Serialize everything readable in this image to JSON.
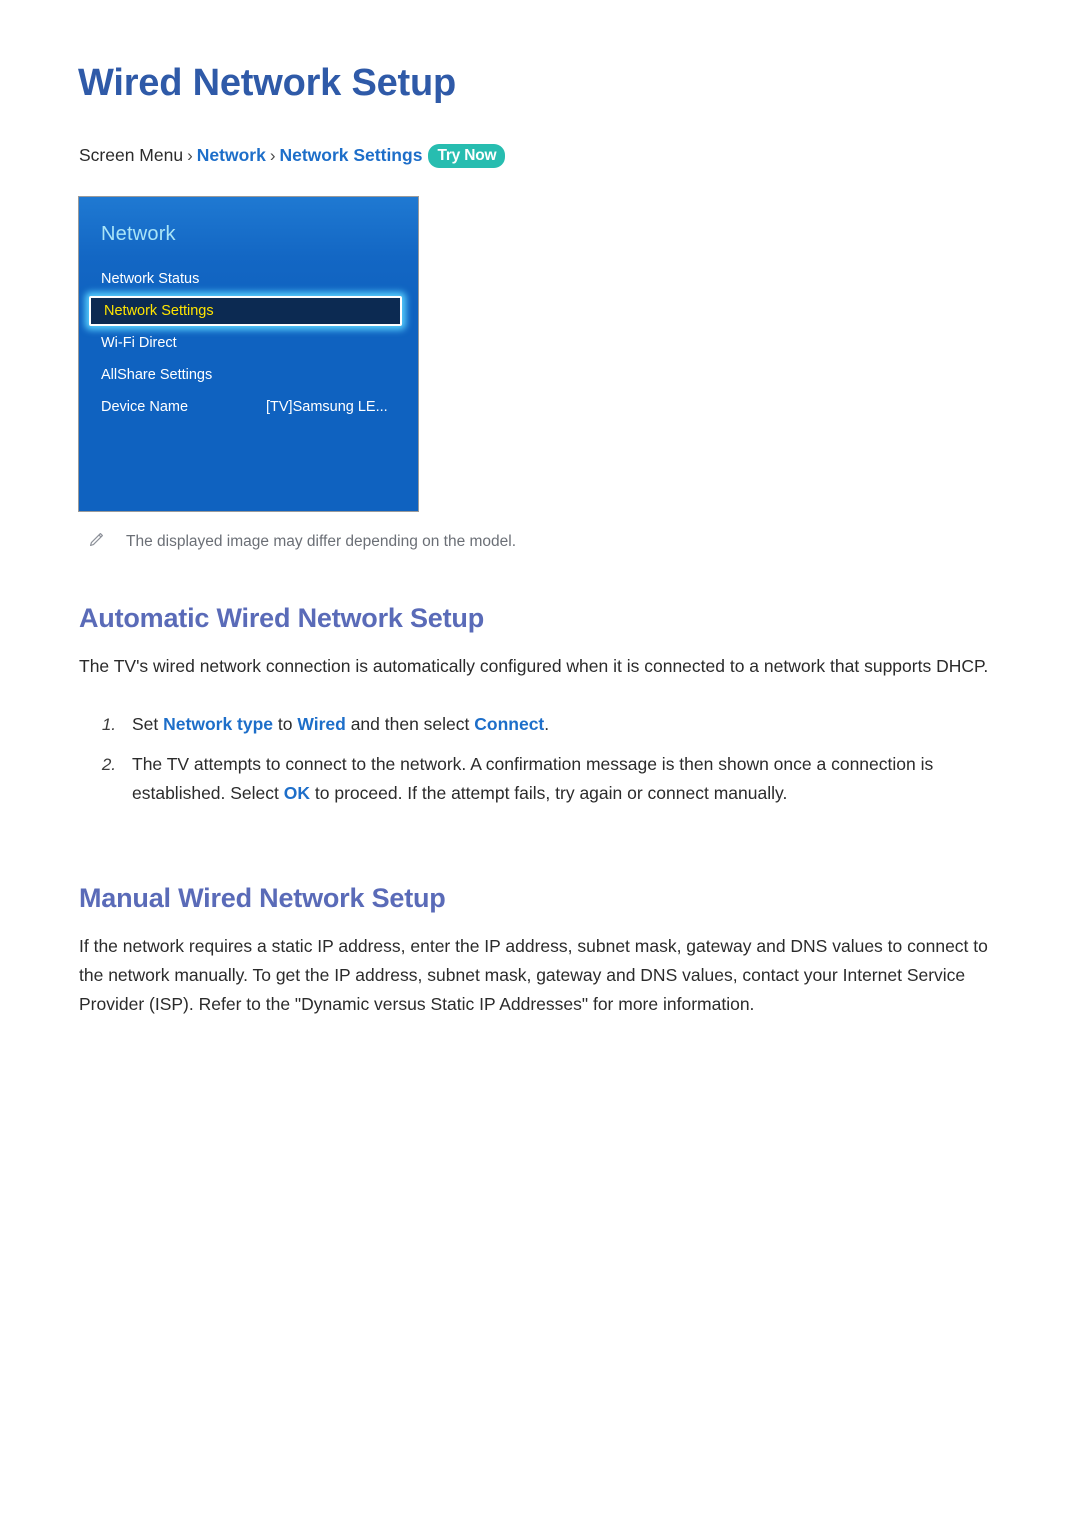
{
  "document": {
    "title": "Wired Network Setup",
    "breadcrumb": {
      "root": "Screen Menu",
      "separator": "›",
      "level1": "Network",
      "level2": "Network Settings",
      "badge": "Try Now"
    },
    "note": {
      "icon": "pencil-icon",
      "text": "The displayed image may differ depending on the model."
    }
  },
  "tv_menu": {
    "title": "Network",
    "rows": [
      {
        "label": "Network Status",
        "value": "",
        "selected": false
      },
      {
        "label": "Network Settings",
        "value": "",
        "selected": true
      },
      {
        "label": "Wi-Fi Direct",
        "value": "",
        "selected": false
      },
      {
        "label": "AllShare Settings",
        "value": "",
        "selected": false
      },
      {
        "label": "Device Name",
        "value": "[TV]Samsung LE...",
        "selected": false
      }
    ]
  },
  "sections": [
    {
      "heading": "Automatic Wired Network Setup",
      "paragraph": "The TV's wired network connection is automatically configured when it is connected to a network that supports DHCP."
    },
    {
      "heading": "Manual Wired Network Setup",
      "paragraph": "If the network requires a static IP address, enter the IP address, subnet mask, gateway and DNS values to connect to the network manually. To get the IP address, subnet mask, gateway and DNS values, contact your Internet Service Provider (ISP). Refer to the \"Dynamic versus Static IP Addresses\" for more information."
    }
  ],
  "steps": [
    {
      "number": "1.",
      "seg1": "Set ",
      "kw1": "Network type",
      "seg2": " to ",
      "kw2": "Wired",
      "seg3": " and then select ",
      "kw3": "Connect",
      "seg4": "."
    },
    {
      "number": "2.",
      "seg1": "The TV attempts to connect to the network. A confirmation message is then shown once a connection is established. Select ",
      "kw1": "OK",
      "seg2": " to proceed. If the attempt fails, try again or connect manually.",
      "kw2": "",
      "seg3": "",
      "kw3": "",
      "seg4": ""
    }
  ],
  "colors": {
    "title_blue": "#2f5aa8",
    "heading_blue": "#5a6bb8",
    "link_blue": "#1d6ec9",
    "badge_teal": "#27bdb0",
    "panel_blue": "#0f62c0",
    "highlight_navy": "#0c2a52",
    "highlight_yellow": "#ffe400",
    "panel_title_cyan": "#a9e4f7",
    "note_gray": "#6b6f76"
  }
}
